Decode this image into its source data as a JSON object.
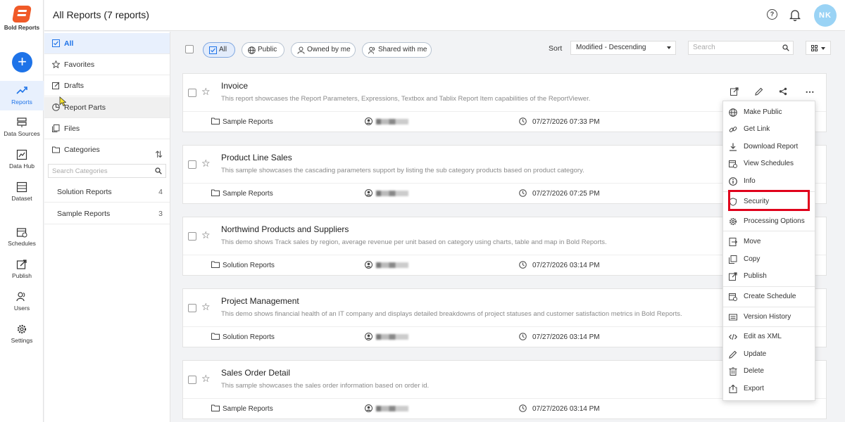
{
  "app": {
    "logo_text": "Bold Reports",
    "user_initials": "NK"
  },
  "rail": [
    {
      "label": "Reports",
      "icon": "trend-icon"
    },
    {
      "label": "Data Sources",
      "icon": "database-icon"
    },
    {
      "label": "Data Hub",
      "icon": "chart-icon"
    },
    {
      "label": "Dataset",
      "icon": "table-icon"
    },
    {
      "label": "Schedules",
      "icon": "calendar-icon"
    },
    {
      "label": "Publish",
      "icon": "publish-icon"
    },
    {
      "label": "Users",
      "icon": "users-icon"
    },
    {
      "label": "Settings",
      "icon": "gear-icon"
    }
  ],
  "header": {
    "title": "All Reports (7 reports)"
  },
  "sidebar": {
    "items": [
      {
        "label": "All"
      },
      {
        "label": "Favorites"
      },
      {
        "label": "Drafts"
      },
      {
        "label": "Report Parts"
      },
      {
        "label": "Files"
      },
      {
        "label": "Categories"
      }
    ],
    "category_search_placeholder": "Search Categories",
    "categories": [
      {
        "name": "Solution Reports",
        "count": "4"
      },
      {
        "name": "Sample Reports",
        "count": "3"
      }
    ]
  },
  "toolbar": {
    "filters": [
      {
        "label": "All"
      },
      {
        "label": "Public"
      },
      {
        "label": "Owned by me"
      },
      {
        "label": "Shared with me"
      }
    ],
    "sort_label": "Sort",
    "sort_value": "Modified - Descending",
    "search_placeholder": "Search"
  },
  "reports": [
    {
      "name": "Invoice",
      "description": "This report showcases the Report Parameters, Expressions, Textbox and Tablix Report Item capabilities of the ReportViewer.",
      "category": "Sample Reports",
      "modified": "07/27/2026 07:33 PM"
    },
    {
      "name": "Product Line Sales",
      "description": "This sample showcases the cascading parameters support by listing the sub category products based on product category.",
      "category": "Sample Reports",
      "modified": "07/27/2026 07:25 PM"
    },
    {
      "name": "Northwind Products and Suppliers",
      "description": "This demo shows Track sales by region, average revenue per unit based on category using charts, table and map in Bold Reports.",
      "category": "Solution Reports",
      "modified": "07/27/2026 03:14 PM"
    },
    {
      "name": "Project Management",
      "description": "This demo shows financial health of an IT company and displays detailed breakdowns of project statuses and customer satisfaction metrics in Bold Reports.",
      "category": "Solution Reports",
      "modified": "07/27/2026 03:14 PM"
    },
    {
      "name": "Sales Order Detail",
      "description": "This sample showcases the sales order information based on order id.",
      "category": "Sample Reports",
      "modified": "07/27/2026 03:14 PM"
    }
  ],
  "menu": [
    {
      "label": "Make Public",
      "icon": "globe-icon"
    },
    {
      "label": "Get Link",
      "icon": "link-icon"
    },
    {
      "label": "Download Report",
      "icon": "download-icon"
    },
    {
      "label": "View Schedules",
      "icon": "calendar-icon"
    },
    {
      "label": "Info",
      "icon": "info-icon"
    },
    {
      "label": "Security",
      "icon": "shield-icon"
    },
    {
      "label": "Processing Options",
      "icon": "gear-icon"
    },
    {
      "label": "Move",
      "icon": "move-icon"
    },
    {
      "label": "Copy",
      "icon": "copy-icon"
    },
    {
      "label": "Publish",
      "icon": "publish-icon"
    },
    {
      "label": "Create Schedule",
      "icon": "calendar-icon"
    },
    {
      "label": "Version History",
      "icon": "history-icon"
    },
    {
      "label": "Edit as XML",
      "icon": "code-icon"
    },
    {
      "label": "Update",
      "icon": "pencil-icon"
    },
    {
      "label": "Delete",
      "icon": "trash-icon"
    },
    {
      "label": "Export",
      "icon": "export-icon"
    }
  ],
  "colors": {
    "accent": "#1e73e8",
    "highlight": "#e0001b",
    "logo": "#f05a28"
  }
}
